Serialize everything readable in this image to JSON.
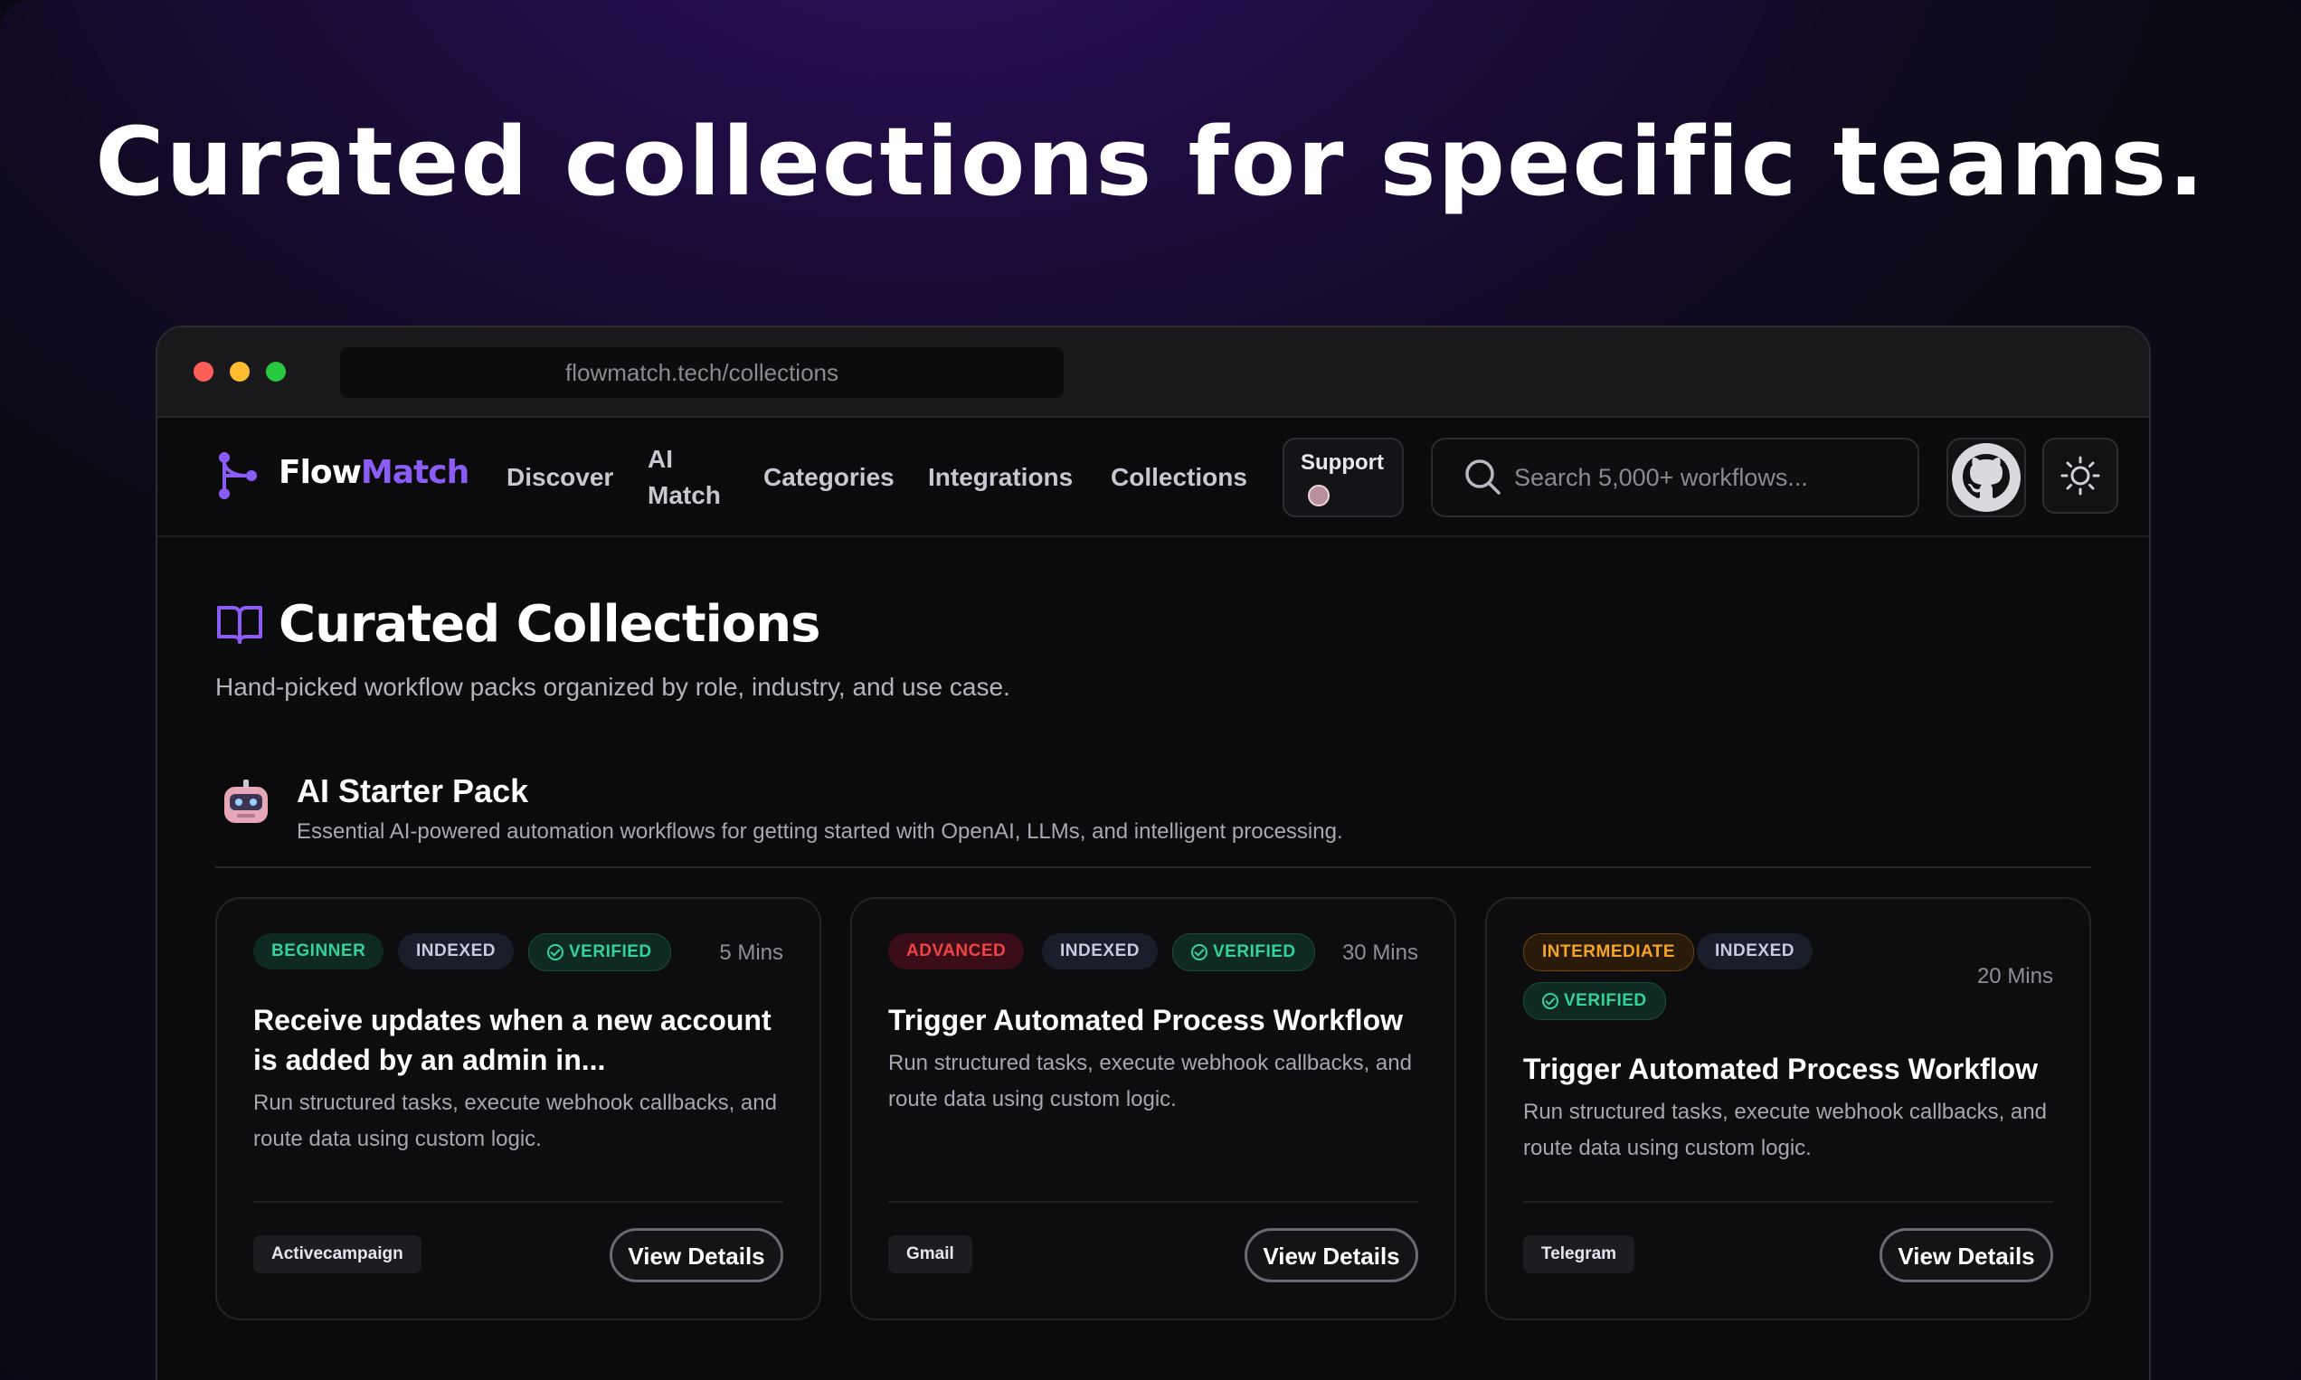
{
  "headline": "Curated collections for specific teams.",
  "browser": {
    "url": "flowmatch.tech/collections"
  },
  "nav": {
    "logo": {
      "prefix": "Flow",
      "accent": "Match"
    },
    "links": [
      "Discover",
      "AI",
      "Match",
      "Categories",
      "Integrations",
      "Collections"
    ],
    "support_label": "Support",
    "search_placeholder": "Search 5,000+ workflows..."
  },
  "page": {
    "title": "Curated Collections",
    "subtitle": "Hand-picked workflow packs organized by role, industry, and use case."
  },
  "pack": {
    "title": "AI Starter Pack",
    "description": "Essential AI-powered automation workflows for getting started with OpenAI, LLMs, and intelligent processing."
  },
  "cards": [
    {
      "level": "BEGINNER",
      "indexed": "INDEXED",
      "verified": "VERIFIED",
      "duration": "5 Mins",
      "title_line1": "Receive updates when a new account",
      "title_line2": "is added by an admin in...",
      "desc_line1": "Run structured tasks, execute webhook callbacks, and",
      "desc_line2": "route data using custom logic.",
      "integration": "Activecampaign",
      "button": "View Details"
    },
    {
      "level": "ADVANCED",
      "indexed": "INDEXED",
      "verified": "VERIFIED",
      "duration": "30 Mins",
      "title_line1": "Trigger Automated Process Workflow",
      "desc_line1": "Run structured tasks, execute webhook callbacks, and",
      "desc_line2": "route data using custom logic.",
      "integration": "Gmail",
      "button": "View Details"
    },
    {
      "level": "INTERMEDIATE",
      "indexed": "INDEXED",
      "verified": "VERIFIED",
      "duration": "20 Mins",
      "title_line1": "Trigger Automated Process Workflow",
      "desc_line1": "Run structured tasks, execute webhook callbacks, and",
      "desc_line2": "route data using custom logic.",
      "integration": "Telegram",
      "button": "View Details"
    }
  ],
  "icons": {
    "logo": "workflow-branch-icon",
    "search": "search-icon",
    "github": "github-icon",
    "theme": "sun-icon",
    "page_title": "open-book-icon",
    "pack": "robot-icon",
    "verified": "check-circle-icon"
  },
  "colors": {
    "accent": "#8b5cf6",
    "beginner": "#34d399",
    "advanced": "#ef4444",
    "intermediate": "#f5a524"
  }
}
